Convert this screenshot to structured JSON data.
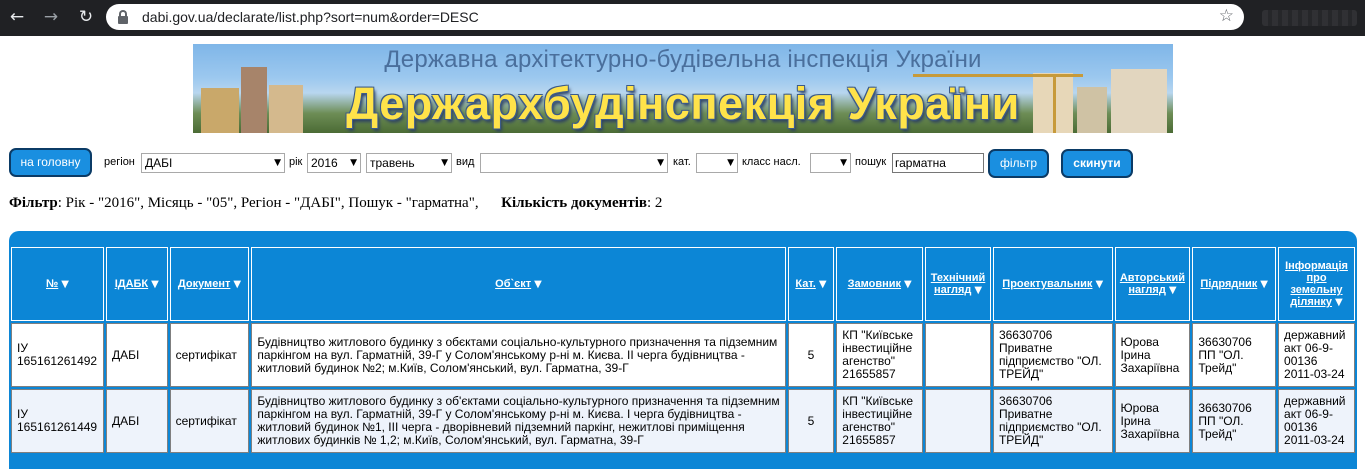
{
  "browser": {
    "url": "dabi.gov.ua/declarate/list.php?sort=num&order=DESC",
    "back_icon": "←",
    "forward_icon": "→",
    "reload_icon": "↻",
    "star_icon": "☆"
  },
  "banner": {
    "subtitle": "Державна архітектурно-будівельна інспекція України",
    "title": "Держархбудінспекція України"
  },
  "filters": {
    "home_button": "на головну",
    "region_label": "регіон",
    "region_value": "ДАБІ",
    "year_label": "рік",
    "year_value": "2016",
    "month_value": "травень",
    "kind_label": "вид",
    "kind_value": "",
    "cat_label": "кат.",
    "cat_value": "",
    "class_label": "класс насл.",
    "class_value": "",
    "search_label": "пошук",
    "search_value": "гарматна",
    "filter_button": "фільтр",
    "reset_button": "скинути",
    "select_arrow": "▼"
  },
  "summary": {
    "filter_label": "Фільтр",
    "filter_text": ": Рік - \"2016\", Місяць - \"05\", Регіон - \"ДАБІ\", Пошук - \"гарматна\",",
    "count_label": "Кількість документів",
    "count_text": ": 2"
  },
  "table": {
    "sort_icon": "▼",
    "headers": [
      "№",
      "ІДАБК",
      "Документ",
      "Об`єкт",
      "Кат.",
      "Замовник",
      "Технічний нагляд",
      "Проектувальник",
      "Авторський нагляд",
      "Підрядник",
      "Інформація про земельну ділянку"
    ],
    "rows": [
      {
        "num": "ІУ 165161261492",
        "idabk": "ДАБІ",
        "doc": "сертифікат",
        "object": "Будівництво житлового будинку з обєктами соціально-культурного призначення та підземним паркінгом на вул. Гарматній, 39-Г у Солом'янському р-ні м. Києва. ІІ черга будівництва - житловий будинок №2; м.Київ, Солом'янський, вул. Гарматна, 39-Г",
        "cat": "5",
        "customer": "КП \"Київське інвестиційне агенство\" 21655857",
        "tech": "",
        "designer": "36630706 Приватне підприємство \"ОЛ. ТРЕЙД\"",
        "author": "Юрова Ірина Захаріївна",
        "contractor": "36630706 ПП \"ОЛ. Трейд\"",
        "land": "державний акт 06-9-00136 2011-03-24"
      },
      {
        "num": "ІУ 165161261449",
        "idabk": "ДАБІ",
        "doc": "сертифікат",
        "object": "Будівництво житлового будинку з об'єктами соціально-культурного призначення та підземним паркінгом на вул. Гарматній, 39-Г у Солом'янському р-ні м. Києва. І черга будівництва - житловий будинок №1, ІІІ черга - дворівневий підземний паркінг, нежитлові приміщення житлових будинків № 1,2; м.Київ, Солом'янський, вул. Гарматна, 39-Г",
        "cat": "5",
        "customer": "КП \"Київське інвестиційне агенство\" 21655857",
        "tech": "",
        "designer": "36630706 Приватне підприємство \"ОЛ. ТРЕЙД\"",
        "author": "Юрова Ірина Захаріївна",
        "contractor": "36630706 ПП \"ОЛ. Трейд\"",
        "land": "державний акт 06-9-00136 2011-03-24"
      }
    ]
  },
  "colors": {
    "button_blue": "#1a8fe0",
    "table_blue": "#0c86d6",
    "banner_title_yellow": "#ffe34a"
  }
}
